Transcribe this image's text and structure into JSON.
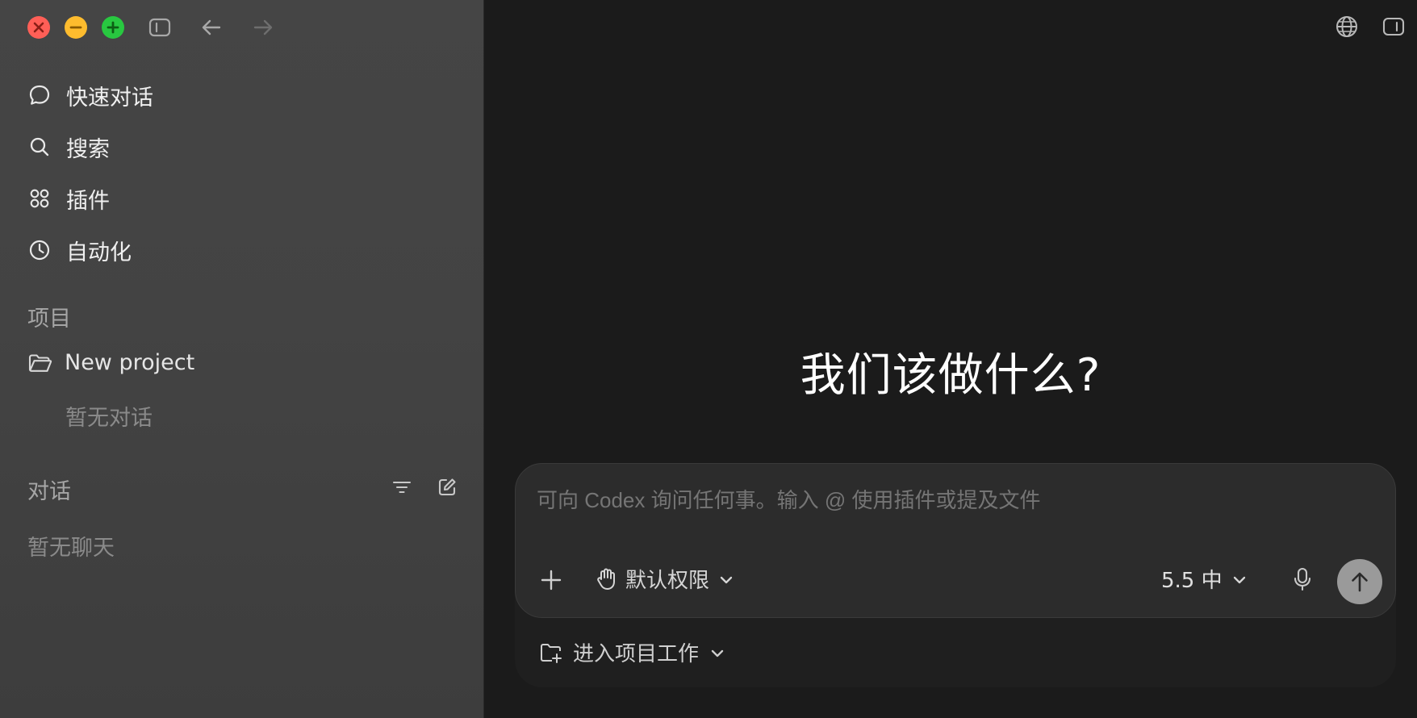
{
  "sidebar": {
    "nav": [
      {
        "label": "快速对话",
        "icon": "chat-bubble-icon"
      },
      {
        "label": "搜索",
        "icon": "search-icon"
      },
      {
        "label": "插件",
        "icon": "plugins-icon"
      },
      {
        "label": "自动化",
        "icon": "clock-icon"
      }
    ],
    "projects_title": "项目",
    "project_name": "New project",
    "project_empty": "暂无对话",
    "chats_title": "对话",
    "chats_empty": "暂无聊天"
  },
  "main": {
    "hero_title": "我们该做什么?",
    "composer": {
      "placeholder": "可向 Codex 询问任何事。输入 @ 使用插件或提及文件",
      "permission_label": "默认权限",
      "model_label": "5.5 中",
      "project_switch_label": "进入项目工作"
    }
  },
  "colors": {
    "sidebar_bg": "#444444",
    "main_bg": "#1b1b1b",
    "composer_bg": "#2c2c2c",
    "send_button": "#9a9a9a"
  }
}
